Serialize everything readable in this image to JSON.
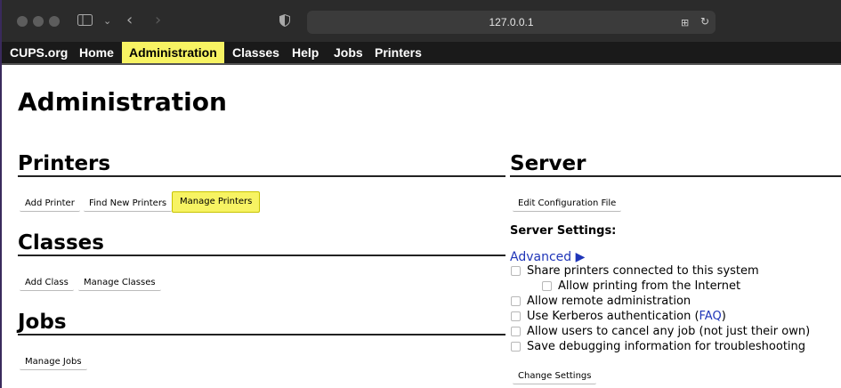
{
  "browser": {
    "url": "127.0.0.1"
  },
  "nav": {
    "items": [
      "CUPS.org",
      "Home",
      "Administration",
      "Classes",
      "Help",
      "Jobs",
      "Printers"
    ]
  },
  "page": {
    "title": "Administration"
  },
  "printers": {
    "heading": "Printers",
    "add": "Add Printer",
    "find": "Find New Printers",
    "manage": "Manage Printers"
  },
  "classes": {
    "heading": "Classes",
    "add": "Add Class",
    "manage": "Manage Classes"
  },
  "jobs": {
    "heading": "Jobs",
    "manage": "Manage Jobs"
  },
  "server": {
    "heading": "Server",
    "edit_config": "Edit Configuration File",
    "settings_label": "Server Settings:",
    "advanced": "Advanced ▶",
    "options": {
      "share": "Share printers connected to this system",
      "internet": "Allow printing from the Internet",
      "remote": "Allow remote administration",
      "kerberos": "Use Kerberos authentication (",
      "faq": "FAQ",
      "kerberos_close": ")",
      "cancel": "Allow users to cancel any job (not just their own)",
      "debug": "Save debugging information for troubleshooting"
    },
    "change": "Change Settings"
  }
}
